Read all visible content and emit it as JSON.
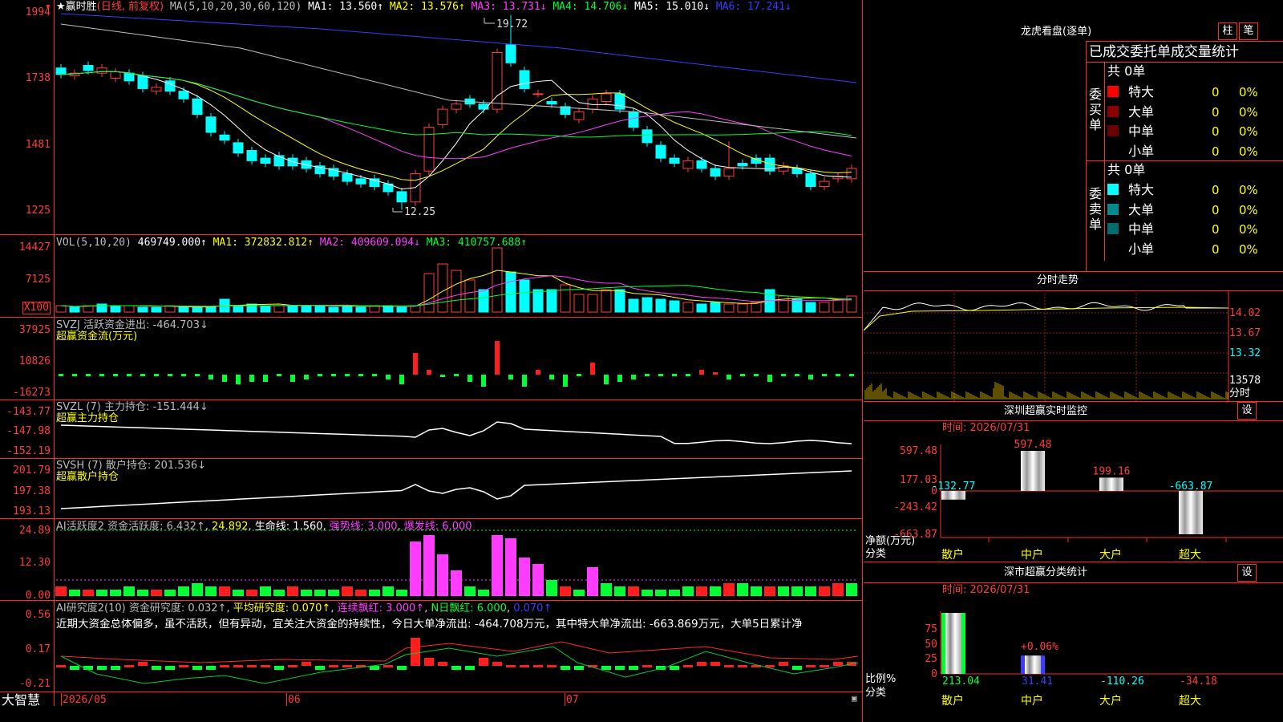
{
  "main": {
    "title": "★赢时胜",
    "mode": "(日线, 前复权)",
    "ma_label": "MA(5,10,20,30,60,120)",
    "ma1": "MA1: 13.560↑",
    "ma2": "MA2: 13.576↑",
    "ma3": "MA3: 13.731↓",
    "ma4": "MA4: 14.706↓",
    "ma5": "MA5: 15.010↓",
    "ma6": "MA6: 17.241↓",
    "y_ticks": [
      "1994",
      "1738",
      "1481",
      "1225"
    ],
    "high_label": "19.72",
    "low_label": "12.25"
  },
  "vol": {
    "label": "VOL(5,10,20)",
    "value": "469749.000↑",
    "ma1": "MA1: 372832.812↑",
    "ma2": "MA2: 409609.094↓",
    "ma3": "MA3: 410757.688↑",
    "y_ticks": [
      "14427",
      "7125"
    ],
    "unit": "X100"
  },
  "svzj": {
    "label": "SVZJ  活跃资金进出: -464.703↓",
    "sub": "超赢资金流(万元)",
    "y_ticks": [
      "37925",
      "10826",
      "-16273"
    ]
  },
  "svzl": {
    "label": "SVZL (7) 主力持仓: -151.444↓",
    "sub": "超赢主力持仓",
    "y_ticks": [
      "-143.77",
      "-147.98",
      "-152.19"
    ]
  },
  "svsh": {
    "label": "SVSH (7) 散户持仓: 201.536↓",
    "sub": "超赢散户持仓",
    "y_ticks": [
      "201.79",
      "197.38",
      "193.13"
    ]
  },
  "ai1": {
    "label": "AI活跃度2 资金活跃度: 6.432↑",
    "v2": "24.892",
    "v3": "生命线: 1.560",
    "v4": "强势线: 3.000",
    "v5": "爆发线: 6.000",
    "y_ticks": [
      "24.89",
      "12.30",
      "0.00"
    ]
  },
  "ai2": {
    "label": "AI研究度2(10) 资金研究度: 0.032↑",
    "v2": "平均研究度: 0.070↑",
    "v3": "连续飘红: 3.000↑",
    "v4": "N日飘红: 6.000",
    "v5": "0.070↑",
    "text": "近期大资金总体偏多，虽不活跃，但有异动，宜关注大资金的持续性，今日大单净流出: -464.708万元，其中特大单净流出: -663.869万元，大单5日累计净",
    "y_ticks": [
      "0.56",
      "0.17",
      "-0.21"
    ]
  },
  "bottom": {
    "brand": "大智慧",
    "dates": [
      "2026/05",
      "06",
      "07"
    ]
  },
  "right": {
    "lh_title": "龙虎看盘(逐单)",
    "btn1": "柱",
    "btn2": "笔",
    "stat_title": "已成交委托单成交量统计",
    "buy_label": "委买单",
    "sell_label": "委卖单",
    "buy_total": "共 0单",
    "sell_total": "共 0单",
    "buy_rows": [
      {
        "name": "特大",
        "val": "0",
        "pct": "0%",
        "color": "#ff0000"
      },
      {
        "name": "大单",
        "val": "0",
        "pct": "0%",
        "color": "#8a0000"
      },
      {
        "name": "中单",
        "val": "0",
        "pct": "0%",
        "color": "#6a0000"
      },
      {
        "name": "小单",
        "val": "0",
        "pct": "0%",
        "color": ""
      }
    ],
    "sell_rows": [
      {
        "name": "特大",
        "val": "0",
        "pct": "0%",
        "color": "#00ffff"
      },
      {
        "name": "大单",
        "val": "0",
        "pct": "0%",
        "color": "#008c8c"
      },
      {
        "name": "中单",
        "val": "0",
        "pct": "0%",
        "color": "#006c6c"
      },
      {
        "name": "小单",
        "val": "0",
        "pct": "0%",
        "color": ""
      }
    ],
    "fs_title": "分时走势",
    "fs_ticks": [
      "14.02",
      "13.67",
      "13.32",
      "13578"
    ],
    "fs_label": "分时",
    "mon_title": "深圳超赢实时监控",
    "mon_btn": "设",
    "mon_time": "时间: 2026/07/31",
    "mon_yticks": [
      "597.48",
      "177.03",
      "0",
      "-243.42",
      "-663.87"
    ],
    "mon_ylabel1": "净额(万元)",
    "mon_ylabel2": "分类",
    "mon_bars": [
      {
        "cat": "散户",
        "val": -132.77,
        "label": "-132.77"
      },
      {
        "cat": "中户",
        "val": 597.48,
        "label": "597.48"
      },
      {
        "cat": "大户",
        "val": 199.16,
        "label": "199.16"
      },
      {
        "cat": "超大",
        "val": -663.87,
        "label": "-663.87"
      }
    ],
    "cls_title": "深市超赢分类统计",
    "cls_btn": "设",
    "cls_time": "时间: 2026/07/31",
    "cls_yticks": [
      "75",
      "50",
      "25",
      "0"
    ],
    "cls_ylabel1": "比例%",
    "cls_ylabel2": "分类",
    "cls_mid_label": "+0.06%",
    "cls_bars": [
      {
        "cat": "散户",
        "pct": 100,
        "label": "213.04",
        "color": "#00ff33"
      },
      {
        "cat": "中户",
        "pct": 30,
        "label": "31.41",
        "color": "#3c3cff"
      },
      {
        "cat": "大户",
        "pct": 0,
        "label": "-110.26",
        "color": "#00ffff"
      },
      {
        "cat": "超大",
        "pct": 0,
        "label": "-34.18",
        "color": "#ff3c3c"
      }
    ]
  }
}
